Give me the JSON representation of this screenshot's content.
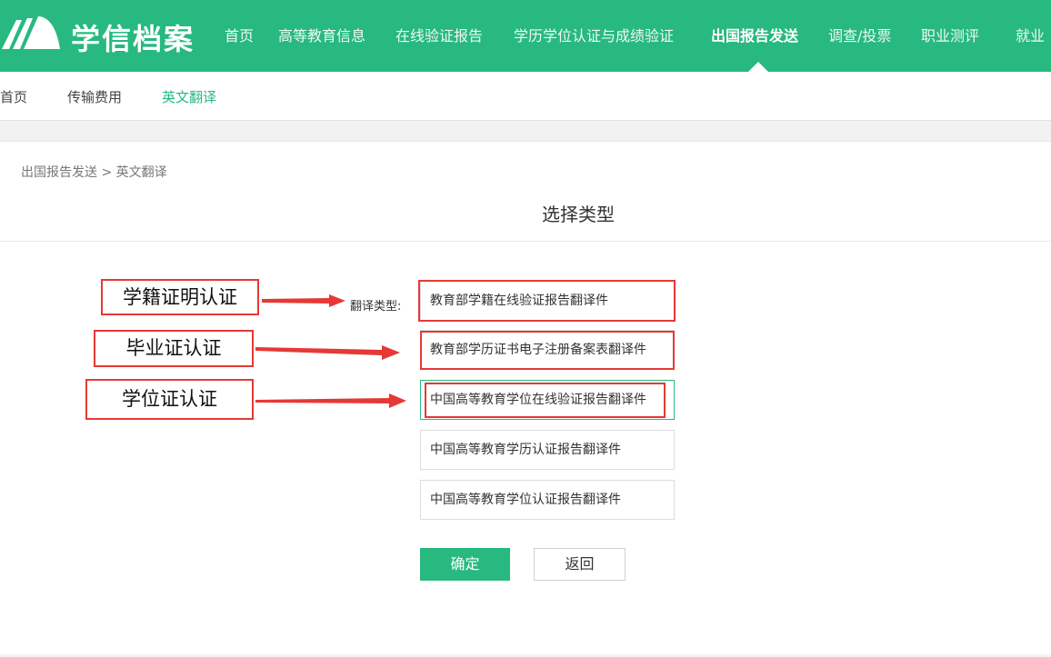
{
  "brand": {
    "name": "学信档案",
    "primary_color": "#27b97f"
  },
  "nav": {
    "items": [
      {
        "label": "首页"
      },
      {
        "label": "高等教育信息"
      },
      {
        "label": "在线验证报告"
      },
      {
        "label": "学历学位认证与成绩验证"
      },
      {
        "label": "出国报告发送",
        "active": true
      },
      {
        "label": "调查/投票"
      },
      {
        "label": "职业测评"
      },
      {
        "label": "就业"
      }
    ]
  },
  "subnav": {
    "items": [
      {
        "label": "首页"
      },
      {
        "label": "传输费用"
      },
      {
        "label": "英文翻译",
        "active": true
      }
    ]
  },
  "breadcrumb": {
    "parent": "出国报告发送",
    "separator": ">",
    "current": "英文翻译"
  },
  "panel": {
    "title": "选择类型"
  },
  "form": {
    "field_label": "翻译类型:",
    "options": [
      {
        "label": "教育部学籍在线验证报告翻译件"
      },
      {
        "label": "教育部学历证书电子注册备案表翻译件"
      },
      {
        "label": "中国高等教育学位在线验证报告翻译件",
        "selected": true
      },
      {
        "label": "中国高等教育学历认证报告翻译件"
      },
      {
        "label": "中国高等教育学位认证报告翻译件"
      }
    ],
    "confirm_label": "确定",
    "back_label": "返回"
  },
  "annotations": {
    "labels": [
      "学籍证明认证",
      "毕业证认证",
      "学位证认证"
    ],
    "color": "#e53935"
  }
}
